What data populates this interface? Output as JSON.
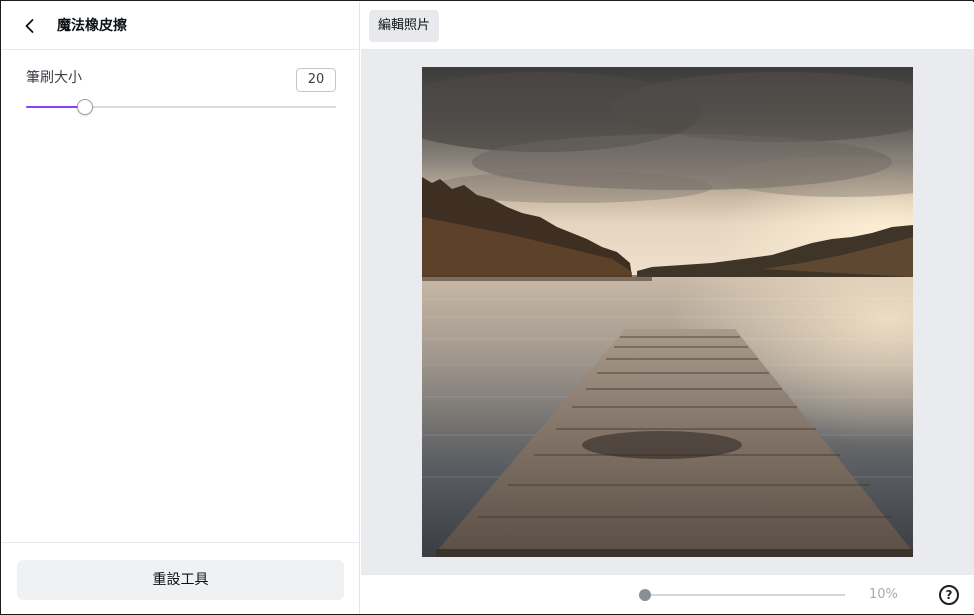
{
  "tool_panel": {
    "title": "魔法橡皮擦",
    "back_icon": "chevron-left-icon",
    "brush_size": {
      "label": "筆刷大小",
      "value": "20",
      "level": 0.19,
      "accent_color": "#8b3dff"
    },
    "reset_label": "重設工具"
  },
  "top_bar": {
    "edit_photo_label": "編輯照片"
  },
  "canvas": {
    "image_description_icon": "photo-lake-pier"
  },
  "bottom_bar": {
    "zoom_label": "10%",
    "zoom_level": 0.0,
    "help_label": "?"
  }
}
